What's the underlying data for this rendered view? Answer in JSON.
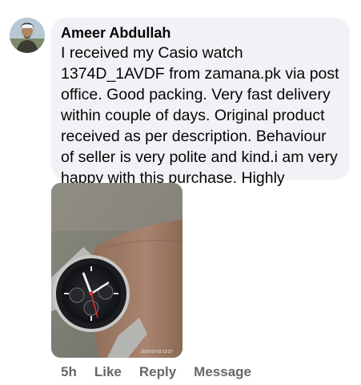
{
  "comment": {
    "author": "Ameer Abdullah",
    "text": "I received my Casio watch 1374D_1AVDF from zamana.pk via post office. Good packing. Very fast delivery within couple of days. Original product received as per description. Behaviour of seller is very polite and kind.i am very happy with this purchase. Highly recommended.",
    "photo_timestamp": "2020-02-03 13:27",
    "timestamp": "5h",
    "actions": {
      "like": "Like",
      "reply": "Reply",
      "message": "Message"
    }
  },
  "colors": {
    "bubble": "#f0f2f5",
    "text": "#050505",
    "meta": "#65676b"
  },
  "icons": {
    "avatar": "user-profile-photo",
    "photo": "casio-watch-on-wrist-photo"
  }
}
